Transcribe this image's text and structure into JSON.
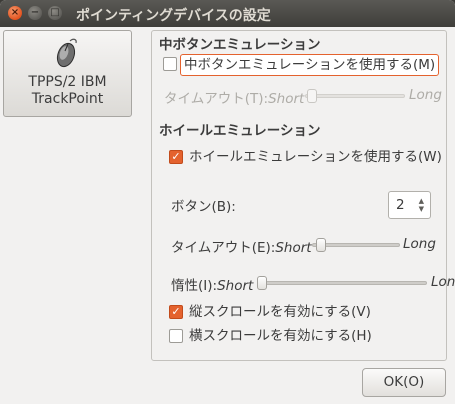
{
  "window": {
    "title": "ポインティングデバイスの設定",
    "close_glyph": "×",
    "min_glyph": "−",
    "max_glyph": "□"
  },
  "device_list": {
    "icon": "mouse-icon",
    "line1": "TPPS/2 IBM",
    "line2": "TrackPoint",
    "selected": true
  },
  "middle_emulation": {
    "section_title": "中ボタンエミュレーション",
    "enable_label": "中ボタンエミュレーションを使用する(M)",
    "enabled": false,
    "timeout_label": "タイムアウト(T):",
    "short_label": "Short",
    "long_label": "Long",
    "timeout_level": 0.0
  },
  "wheel_emulation": {
    "section_title": "ホイールエミュレーション",
    "enable_label": "ホイールエミュレーションを使用する(W)",
    "enabled": true,
    "button_label": "ボタン(B):",
    "button_value": "2",
    "timeout_label": "タイムアウト(E):",
    "timeout_short": "Short",
    "timeout_long": "Long",
    "timeout_level": 0.04,
    "inertia_label": "惰性(I):",
    "inertia_short": "Short",
    "inertia_long": "Long",
    "inertia_level": 0.0,
    "vertical_label": "縦スクロールを有効にする(V)",
    "vertical_enabled": true,
    "horizontal_label": "横スクロールを有効にする(H)",
    "horizontal_enabled": false
  },
  "footer": {
    "ok_label": "OK(O)"
  },
  "colors": {
    "accent": "#e4622e",
    "titlebar": "#3f3e3a",
    "background": "#f2f1f0"
  }
}
